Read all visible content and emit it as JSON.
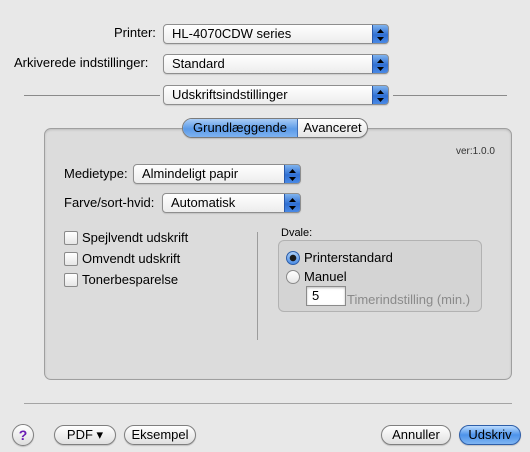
{
  "printer": {
    "label": "Printer:",
    "value": "HL-4070CDW series"
  },
  "presets": {
    "label": "Arkiverede indstillinger:",
    "value": "Standard"
  },
  "section_popup": {
    "value": "Udskriftsindstillinger"
  },
  "tabs": [
    {
      "label": "Grundlæggende",
      "selected": true
    },
    {
      "label": "Avanceret",
      "selected": false
    }
  ],
  "version": "ver:1.0.0",
  "media_type": {
    "label": "Medietype:",
    "value": "Almindeligt papir"
  },
  "color_mode": {
    "label": "Farve/sort-hvid:",
    "value": "Automatisk"
  },
  "options": [
    {
      "label": "Spejlvendt udskrift",
      "checked": false
    },
    {
      "label": "Omvendt udskrift",
      "checked": false
    },
    {
      "label": "Tonerbesparelse",
      "checked": false
    }
  ],
  "sleep": {
    "title": "Dvale:",
    "radio_default": "Printerstandard",
    "radio_manual": "Manuel",
    "selected": "Printerstandard",
    "timer_value": "5",
    "timer_label": "Timerindstilling (min.)"
  },
  "footer": {
    "help": "?",
    "pdf": "PDF ▾",
    "preview": "Eksempel",
    "cancel": "Annuller",
    "print": "Udskriv"
  },
  "colors": {
    "accent": "#4d93ea",
    "background": "#e8e8e8",
    "panel": "#dcdcdc"
  }
}
